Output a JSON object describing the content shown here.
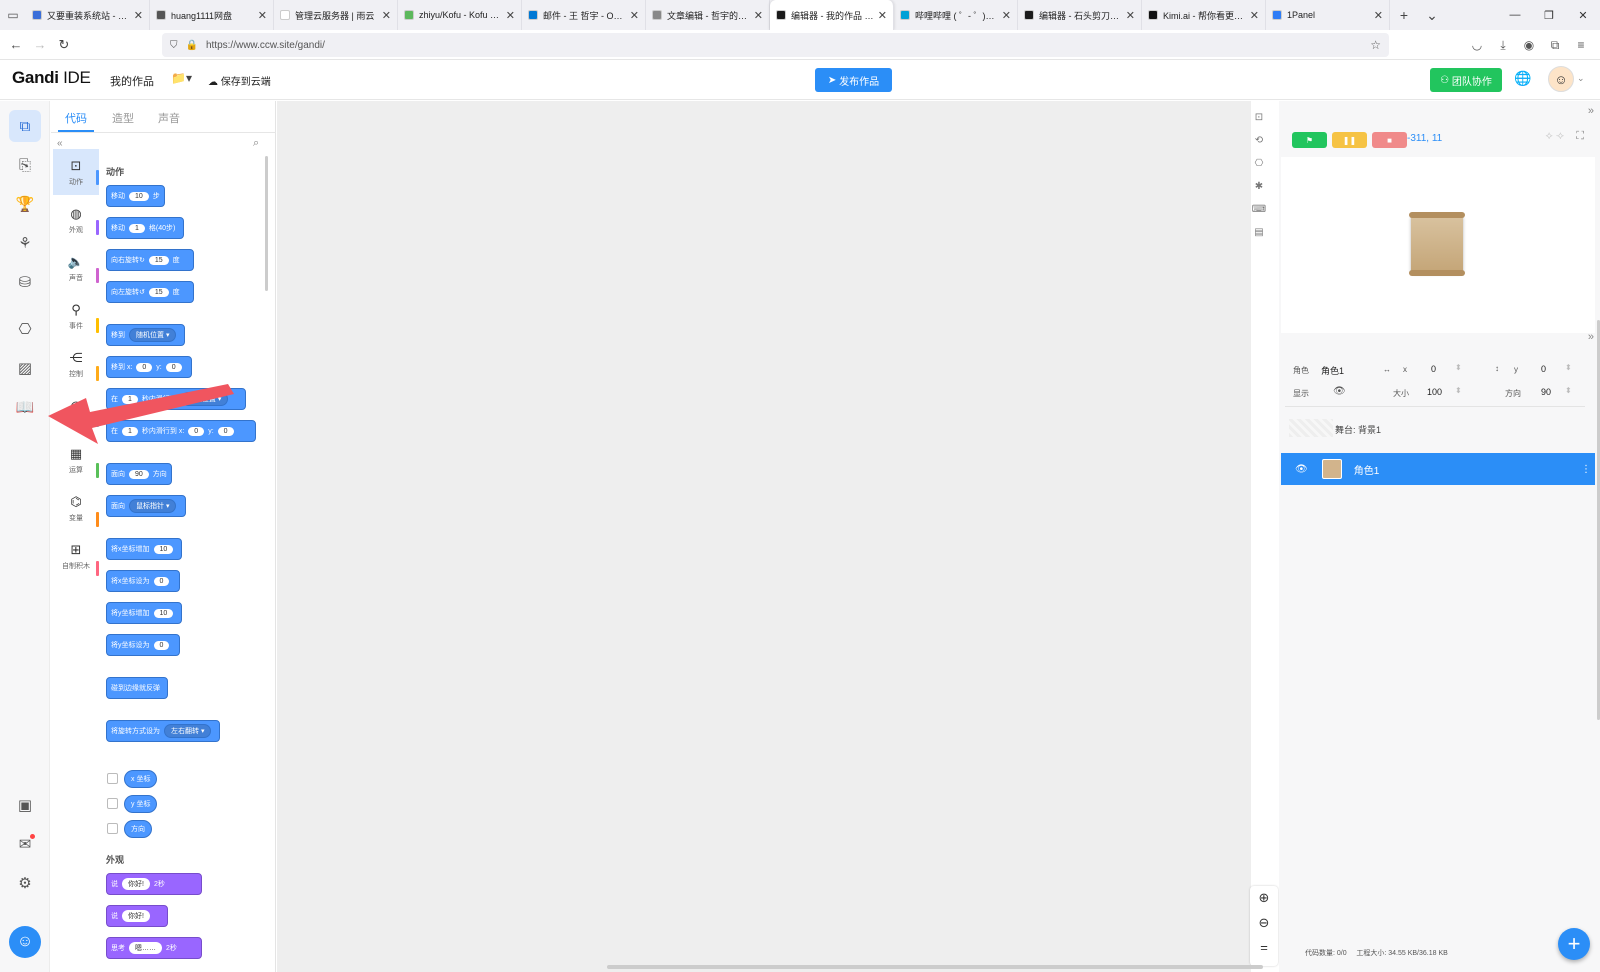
{
  "browser": {
    "tabs": [
      {
        "title": "又要重装系统站 - 精品",
        "color": "#3b6fd9"
      },
      {
        "title": "huang1111网盘",
        "color": "#555555"
      },
      {
        "title": "管理云服务器 | 雨云",
        "color": "#ffffff"
      },
      {
        "title": "zhiyu/Kofu - Kofu - Ui",
        "color": "#5cb85c"
      },
      {
        "title": "邮件 - 王 哲宇 - Outlook",
        "color": "#0078d4"
      },
      {
        "title": "文章编辑 - 哲宇的个人",
        "color": "#888888"
      },
      {
        "title": "编辑器 - 我的作品 - 共",
        "color": "#1a1a1a"
      },
      {
        "title": "哔哩哔哩 ( ゜- ゜)つロ 干",
        "color": "#00a1d6"
      },
      {
        "title": "编辑器 - 石头剪刀布 - 3",
        "color": "#1a1a1a"
      },
      {
        "title": "Kimi.ai - 帮你看更大的",
        "color": "#111111"
      },
      {
        "title": "1Panel",
        "color": "#2e7df6"
      }
    ],
    "url": "https://www.ccw.site/gandi/"
  },
  "header": {
    "logo_main": "Gandi",
    "logo_sub": " IDE",
    "my_works": "我的作品",
    "folder_caret": "📁▾",
    "save_cloud": "保存到云端",
    "publish": "发布作品",
    "team": "团队协作"
  },
  "palette": {
    "tabs": [
      "代码",
      "造型",
      "声音"
    ],
    "categories": [
      {
        "icon": "⊡",
        "label": "动作",
        "color": "#4c97ff"
      },
      {
        "icon": "◍",
        "label": "外观",
        "color": "#9966ff"
      },
      {
        "icon": "🔈",
        "label": "声音",
        "color": "#cf63cf"
      },
      {
        "icon": "⚲",
        "label": "事件",
        "color": "#ffbf00"
      },
      {
        "icon": "⋲",
        "label": "控制",
        "color": "#ffab19"
      },
      {
        "icon": "◎",
        "label": "侦测",
        "color": "#5cb1d6"
      },
      {
        "icon": "▦",
        "label": "运算",
        "color": "#59c059"
      },
      {
        "icon": "⌬",
        "label": "变量",
        "color": "#ff8c1a"
      },
      {
        "icon": "⊞",
        "label": "自制积木",
        "color": "#ff6680"
      }
    ],
    "section_motion": "动作",
    "section_looks": "外观",
    "blocks": {
      "move": [
        "移动",
        "10",
        "步"
      ],
      "move_grid": [
        "移动",
        "1",
        "格(40步)"
      ],
      "turn_right": [
        "向右旋转",
        "↻",
        "15",
        "度"
      ],
      "turn_left": [
        "向左旋转",
        "↺",
        "15",
        "度"
      ],
      "goto": [
        "移到",
        "随机位置 ▾"
      ],
      "goto_xy": [
        "移到 x:",
        "0",
        "y:",
        "0"
      ],
      "glide_to": [
        "在",
        "1",
        "秒内滑行到",
        "随机位置 ▾"
      ],
      "glide_xy": [
        "在",
        "1",
        "秒内滑行到 x:",
        "0",
        "y:",
        "0"
      ],
      "point_dir": [
        "面向",
        "90",
        "方向"
      ],
      "point_to": [
        "面向",
        "鼠标指针 ▾"
      ],
      "change_x": [
        "将x坐标增加",
        "10"
      ],
      "set_x": [
        "将x坐标设为",
        "0"
      ],
      "change_y": [
        "将y坐标增加",
        "10"
      ],
      "set_y": [
        "将y坐标设为",
        "0"
      ],
      "bounce": [
        "碰到边缘就反弹"
      ],
      "rotation_style": [
        "将旋转方式设为",
        "左右翻转 ▾"
      ],
      "rep_x": "x 坐标",
      "rep_y": "y 坐标",
      "rep_dir": "方向",
      "say_secs": [
        "说",
        "你好!",
        "2",
        "秒"
      ],
      "say": [
        "说",
        "你好!"
      ],
      "think_secs": [
        "思考",
        "嗯……",
        "2",
        "秒"
      ]
    }
  },
  "stage": {
    "coords": "-311, 11"
  },
  "sprite_info": {
    "label_sprite": "角色",
    "sprite_name": "角色1",
    "label_x": "x",
    "x": "0",
    "label_y": "y",
    "y": "0",
    "label_show": "显示",
    "label_size": "大小",
    "size": "100",
    "label_dir": "方向",
    "direction": "90",
    "stage_label": "舞台: 背景1",
    "selected_sprite": "角色1"
  },
  "footer": {
    "code_count": "代码数量: 0/0",
    "project_size": "工程大小: 34.55 KB/36.18 KB"
  }
}
